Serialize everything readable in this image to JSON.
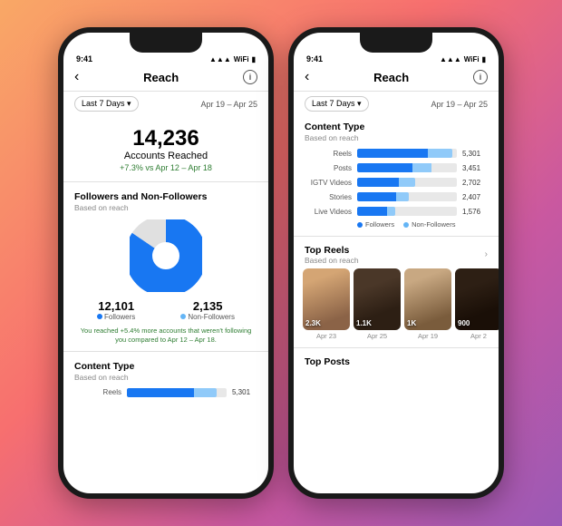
{
  "background": {
    "gradient": "peach-to-purple"
  },
  "phone1": {
    "status_bar": {
      "time": "9:41",
      "signal": "●●●",
      "wifi": "wifi",
      "battery": "battery"
    },
    "header": {
      "title": "Reach",
      "back_label": "‹",
      "info_label": "i"
    },
    "date_filter": {
      "dropdown_label": "Last 7 Days ▾",
      "date_range": "Apr 19 – Apr 25"
    },
    "accounts_reached": {
      "number": "14,236",
      "label": "Accounts Reached",
      "change": "+7.3% vs Apr 12 – Apr 18"
    },
    "followers_section": {
      "title": "Followers and Non-Followers",
      "subtitle": "Based on reach",
      "followers_count": "12,101",
      "followers_label": "Followers",
      "nonfollowers_count": "2,135",
      "nonfollowers_label": "Non-Followers",
      "note": "You reached +5.4% more accounts that weren't following you compared to Apr 12 – Apr 18."
    },
    "content_type_section": {
      "title": "Content Type",
      "subtitle": "Based on reach",
      "bars": [
        {
          "label": "Reels",
          "value": 5301,
          "followers_pct": 75,
          "nonfollowers_pct": 25
        }
      ]
    }
  },
  "phone2": {
    "status_bar": {
      "time": "9:41"
    },
    "header": {
      "title": "Reach",
      "back_label": "‹",
      "info_label": "i"
    },
    "date_filter": {
      "dropdown_label": "Last 7 Days ▾",
      "date_range": "Apr 19 – Apr 25"
    },
    "content_type_section": {
      "title": "Content Type",
      "subtitle": "Based on reach",
      "bars": [
        {
          "label": "Reels",
          "value": "5,301",
          "followers_pct": 75,
          "nonfollowers_pct": 25
        },
        {
          "label": "Posts",
          "value": "3,451",
          "followers_pct": 65,
          "nonfollowers_pct": 22
        },
        {
          "label": "IGTV Videos",
          "value": "2,702",
          "followers_pct": 58,
          "nonfollowers_pct": 18
        },
        {
          "label": "Stories",
          "value": "2,407",
          "followers_pct": 52,
          "nonfollowers_pct": 16
        },
        {
          "label": "Live Videos",
          "value": "1,576",
          "followers_pct": 40,
          "nonfollowers_pct": 12
        }
      ],
      "legend_followers": "Followers",
      "legend_nonfollowers": "Non-Followers"
    },
    "top_reels_section": {
      "title": "Top Reels",
      "subtitle": "Based on reach",
      "reels": [
        {
          "count": "2.3K",
          "date": "Apr 23"
        },
        {
          "count": "1.1K",
          "date": "Apr 25"
        },
        {
          "count": "1K",
          "date": "Apr 19"
        },
        {
          "count": "900",
          "date": "Apr 2"
        }
      ]
    },
    "top_posts_section": {
      "title": "Top Posts"
    }
  }
}
